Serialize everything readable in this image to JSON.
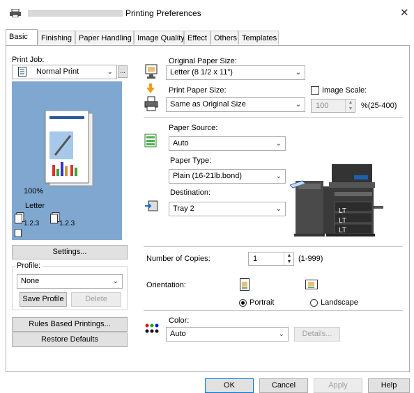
{
  "window": {
    "title": "Printing Preferences",
    "close_glyph": "✕"
  },
  "tabs": [
    "Basic",
    "Finishing",
    "Paper Handling",
    "Image Quality",
    "Effect",
    "Others",
    "Templates"
  ],
  "left": {
    "print_job_label": "Print Job:",
    "print_job_value": "Normal Print",
    "more_button": "...",
    "preview": {
      "scale": "100%",
      "paper": "Letter",
      "collate_a": "1.2.3",
      "collate_b": "1.2.3"
    },
    "settings_button": "Settings...",
    "profile_label": "Profile:",
    "profile_value": "None",
    "save_profile_button": "Save Profile",
    "delete_button": "Delete",
    "rules_button": "Rules Based Printings...",
    "restore_button": "Restore Defaults"
  },
  "right": {
    "original_size_label": "Original Paper Size:",
    "original_size_value": "Letter (8 1/2 x 11\")",
    "print_size_label": "Print Paper Size:",
    "print_size_value": "Same as Original Size",
    "image_scale_label": "Image Scale:",
    "image_scale_value": "100",
    "image_scale_range": "%(25-400)",
    "paper_source_label": "Paper Source:",
    "paper_source_value": "Auto",
    "paper_type_label": "Paper Type:",
    "paper_type_value": "Plain (16-21lb.bond)",
    "destination_label": "Destination:",
    "destination_value": "Tray 2",
    "tray_labels": [
      "LT",
      "LT",
      "LT"
    ],
    "copies_label": "Number of Copies:",
    "copies_value": "1",
    "copies_range": "(1-999)",
    "orientation_label": "Orientation:",
    "portrait_label": "Portrait",
    "landscape_label": "Landscape",
    "color_label": "Color:",
    "color_value": "Auto",
    "details_button": "Details..."
  },
  "footer": {
    "ok": "OK",
    "cancel": "Cancel",
    "apply": "Apply",
    "help": "Help"
  },
  "colors": {
    "preview_bg": "#7fa7cf",
    "arrow": "#f39c12",
    "printer": "#3a3a3a"
  }
}
